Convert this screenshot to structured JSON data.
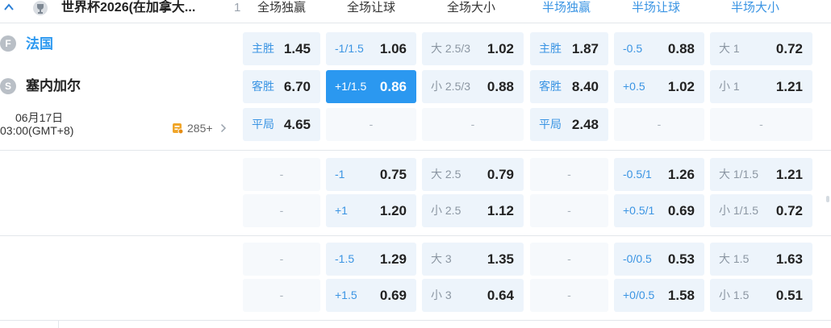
{
  "header": {
    "league": "世界杯2026(在加拿大...",
    "count": "1",
    "columns": [
      "全场独赢",
      "全场让球",
      "全场大小",
      "半场独赢",
      "半场让球",
      "半场大小"
    ]
  },
  "match": {
    "home": {
      "badge": "F",
      "name": "法国"
    },
    "away": {
      "badge": "S",
      "name": "塞内加尔"
    },
    "date": "06月17日",
    "time": "03:00(GMT+8)",
    "more_count": "285+"
  },
  "markets": {
    "r1": {
      "ml_home": {
        "label": "主胜",
        "odds": "1.45"
      },
      "ah_home": {
        "label": "-1/1.5",
        "odds": "1.06"
      },
      "ou_over": {
        "label": "大 2.5/3",
        "odds": "1.02"
      },
      "h_ml_home": {
        "label": "主胜",
        "odds": "1.87"
      },
      "h_ah_home": {
        "label": "-0.5",
        "odds": "0.88"
      },
      "h_ou_over": {
        "label": "大 1",
        "odds": "0.72"
      }
    },
    "r2": {
      "ml_away": {
        "label": "客胜",
        "odds": "6.70"
      },
      "ah_away": {
        "label": "+1/1.5",
        "odds": "0.86"
      },
      "ou_under": {
        "label": "小 2.5/3",
        "odds": "0.88"
      },
      "h_ml_away": {
        "label": "客胜",
        "odds": "8.40"
      },
      "h_ah_away": {
        "label": "+0.5",
        "odds": "1.02"
      },
      "h_ou_under": {
        "label": "小 1",
        "odds": "1.21"
      }
    },
    "r3": {
      "ml_draw": {
        "label": "平局",
        "odds": "4.65"
      },
      "h_ml_draw": {
        "label": "平局",
        "odds": "2.48"
      }
    },
    "r4": {
      "ah": {
        "label": "-1",
        "odds": "0.75"
      },
      "ou": {
        "label": "大 2.5",
        "odds": "0.79"
      },
      "h_ah": {
        "label": "-0.5/1",
        "odds": "1.26"
      },
      "h_ou": {
        "label": "大 1/1.5",
        "odds": "1.21"
      }
    },
    "r5": {
      "ah": {
        "label": "+1",
        "odds": "1.20"
      },
      "ou": {
        "label": "小 2.5",
        "odds": "1.12"
      },
      "h_ah": {
        "label": "+0.5/1",
        "odds": "0.69"
      },
      "h_ou": {
        "label": "小 1/1.5",
        "odds": "0.72"
      }
    },
    "r6": {
      "ah": {
        "label": "-1.5",
        "odds": "1.29"
      },
      "ou": {
        "label": "大 3",
        "odds": "1.35"
      },
      "h_ah": {
        "label": "-0/0.5",
        "odds": "0.53"
      },
      "h_ou": {
        "label": "大 1.5",
        "odds": "1.63"
      }
    },
    "r7": {
      "ah": {
        "label": "+1.5",
        "odds": "0.69"
      },
      "ou": {
        "label": "小 3",
        "odds": "0.64"
      },
      "h_ah": {
        "label": "+0/0.5",
        "odds": "1.58"
      },
      "h_ou": {
        "label": "小 1.5",
        "odds": "0.51"
      }
    }
  },
  "empty": "-",
  "colors": {
    "accent": "#2b98f0",
    "label_blue": "#3a94e3",
    "cell_bg": "#edf4fb",
    "header_full": "#333333",
    "header_half": "#3a94e3"
  }
}
